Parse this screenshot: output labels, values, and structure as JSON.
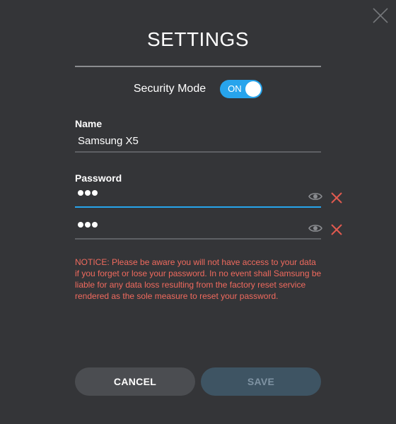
{
  "dialog": {
    "title": "SETTINGS",
    "close_icon": "close-icon"
  },
  "security": {
    "label": "Security Mode",
    "toggle_state": "ON",
    "accent_color": "#27a4ec"
  },
  "name": {
    "label": "Name",
    "value": "Samsung X5"
  },
  "password": {
    "label": "Password",
    "fields": [
      {
        "masked_length": 3,
        "show_icon": "eye-icon",
        "clear_icon": "clear-x-icon",
        "focused": true
      },
      {
        "masked_length": 3,
        "show_icon": "eye-icon",
        "clear_icon": "clear-x-icon",
        "focused": false
      }
    ]
  },
  "notice": {
    "text": "NOTICE: Please be aware you will not have access to your data if you forget or lose your password. In no event shall Samsung be liable for any data loss resulting from the factory reset service rendered as the sole measure to reset your password.",
    "color": "#f06a5e"
  },
  "buttons": {
    "cancel_label": "CANCEL",
    "save_label": "SAVE"
  }
}
